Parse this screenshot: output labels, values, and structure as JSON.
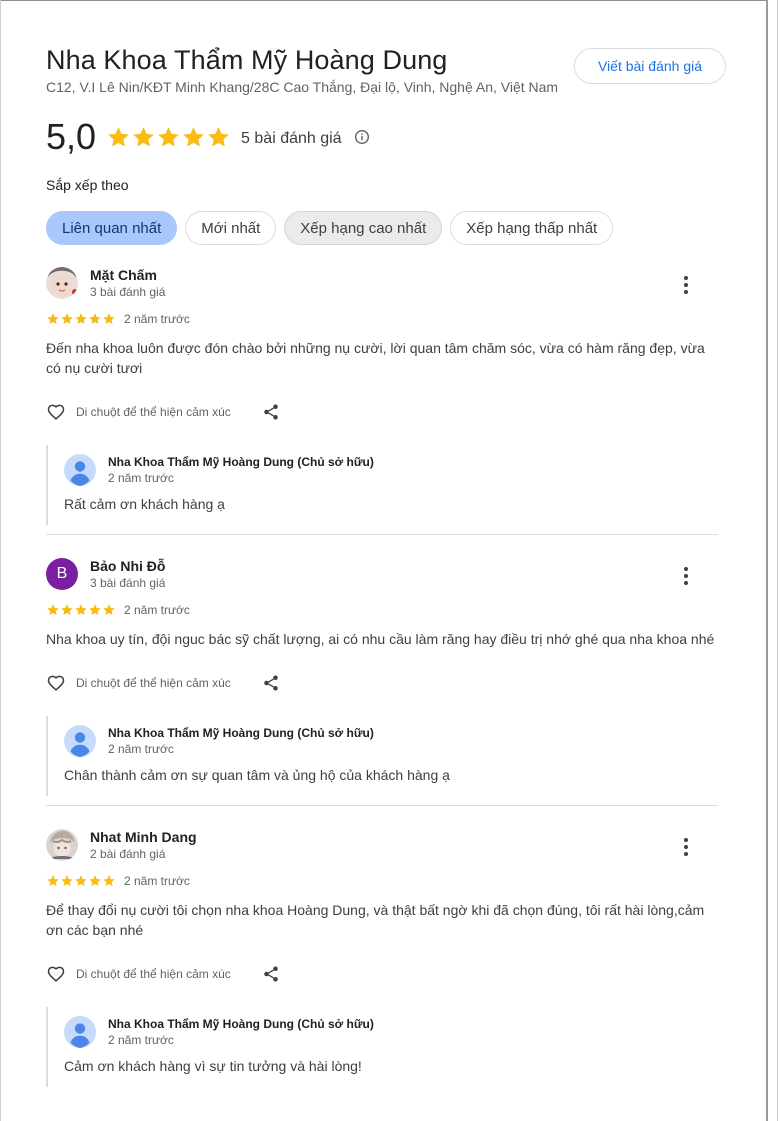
{
  "place": {
    "name": "Nha Khoa Thẩm Mỹ Hoàng Dung",
    "address": "C12, V.I Lê Nin/KĐT Minh Khang/28C Cao Thắng, Đại lộ, Vinh, Nghệ An, Việt Nam",
    "write_review_label": "Viết bài đánh giá"
  },
  "summary": {
    "rating": "5,0",
    "stars": 5,
    "count_label": "5 bài đánh giá"
  },
  "sort": {
    "label": "Sắp xếp theo",
    "options": [
      "Liên quan nhất",
      "Mới nhất",
      "Xếp hạng cao nhất",
      "Xếp hạng thấp nhất"
    ],
    "selected": "Liên quan nhất"
  },
  "reviews": [
    {
      "name": "Mặt Chấm",
      "meta": "3 bài đánh giá",
      "stars": 5,
      "time": "2 năm trước",
      "text": "Đến nha khoa luôn được đón chào bởi những nụ cười, lời quan tâm chăm sóc, vừa có hàm răng đẹp, vừa có nụ cười tươi",
      "react_label": "Di chuột để thể hiện cảm xúc",
      "reply": {
        "owner": "Nha Khoa Thẩm Mỹ Hoàng Dung (Chủ sở hữu)",
        "time": "2 năm trước",
        "text": "Rất cảm ơn khách hàng ạ"
      }
    },
    {
      "name": "Bảo Nhi Đỗ",
      "initial": "B",
      "meta": "3 bài đánh giá",
      "stars": 5,
      "time": "2 năm trước",
      "text": "Nha khoa uy tín, đội nguc bác sỹ chất lượng, ai có nhu cầu làm răng hay điều trị nhớ ghé qua nha khoa nhé",
      "react_label": "Di chuột để thể hiện cảm xúc",
      "reply": {
        "owner": "Nha Khoa Thẩm Mỹ Hoàng Dung (Chủ sở hữu)",
        "time": "2 năm trước",
        "text": "Chân thành cảm ơn sự quan tâm và ủng hộ của khách hàng ạ"
      }
    },
    {
      "name": "Nhat Minh Dang",
      "meta": "2 bài đánh giá",
      "stars": 5,
      "time": "2 năm trước",
      "text": "Để thay đổi nụ cười tôi chọn nha khoa Hoàng Dung, và thật bất ngờ khi đã chọn đúng, tôi rất hài lòng,cảm ơn các bạn nhé",
      "react_label": "Di chuột để thể hiện cảm xúc",
      "reply": {
        "owner": "Nha Khoa Thẩm Mỹ Hoàng Dung (Chủ sở hữu)",
        "time": "2 năm trước",
        "text": "Cảm ơn khách hàng vì sự tin tưởng và hài lòng!"
      }
    }
  ],
  "colors": {
    "star": "#f9bc15",
    "link": "#1a73e8",
    "chip_selected": "#a8c7fa",
    "avatar_letter_bg": "#7b1fa2"
  }
}
